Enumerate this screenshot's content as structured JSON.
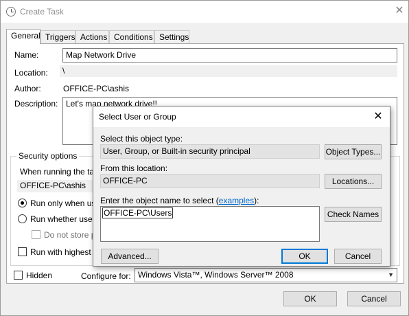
{
  "window": {
    "title": "Create Task",
    "close_label": "✕"
  },
  "tabs": [
    {
      "label": "General"
    },
    {
      "label": "Triggers"
    },
    {
      "label": "Actions"
    },
    {
      "label": "Conditions"
    },
    {
      "label": "Settings"
    }
  ],
  "general": {
    "name_label": "Name:",
    "name_value": "Map Network Drive",
    "location_label": "Location:",
    "location_value": "\\",
    "author_label": "Author:",
    "author_value": "OFFICE-PC\\ashis",
    "description_label": "Description:",
    "description_value": "Let's map network drive!!"
  },
  "security": {
    "group_label": "Security options",
    "running_as_label": "When running the tas",
    "user_value": "OFFICE-PC\\ashis",
    "run_only_logged_on": "Run only when use",
    "run_whether": "Run whether user i",
    "do_not_store": "Do not store p",
    "run_highest": "Run with highest p",
    "run_only_logged_on_selected": true
  },
  "bottom": {
    "hidden_label": "Hidden",
    "configure_label": "Configure for:",
    "configure_value": "Windows Vista™, Windows Server™ 2008",
    "ok_label": "OK",
    "cancel_label": "Cancel"
  },
  "dialog": {
    "title": "Select User or Group",
    "close_label": "✕",
    "object_type_label": "Select this object type:",
    "object_type_value": "User, Group, or Built-in security principal",
    "object_types_button": "Object Types...",
    "location_label": "From this location:",
    "location_value": "OFFICE-PC",
    "locations_button": "Locations...",
    "enter_label_prefix": "Enter the object name to select (",
    "examples_link": "examples",
    "enter_label_suffix": "):",
    "object_name_value": "OFFICE-PC\\Users",
    "check_names_button": "Check Names",
    "advanced_button": "Advanced...",
    "ok_label": "OK",
    "cancel_label": "Cancel"
  }
}
